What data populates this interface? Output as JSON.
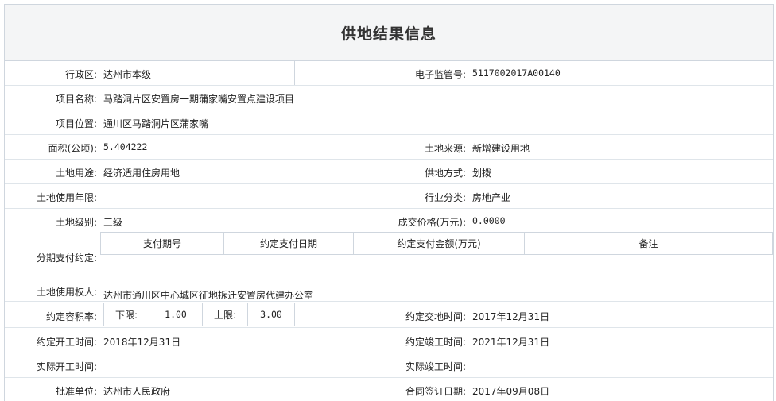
{
  "title": "供地结果信息",
  "fields": {
    "district_label": "行政区:",
    "district_value": "达州市本级",
    "supervision_no_label": "电子监管号:",
    "supervision_no_value": "5117002017A00140",
    "project_name_label": "项目名称:",
    "project_name_value": "马踏洞片区安置房一期蒲家嘴安置点建设项目",
    "project_location_label": "项目位置:",
    "project_location_value": "通川区马踏洞片区蒲家嘴",
    "area_label": "面积(公顷):",
    "area_value": "5.404222",
    "land_source_label": "土地来源:",
    "land_source_value": "新增建设用地",
    "land_use_label": "土地用途:",
    "land_use_value": "经济适用住房用地",
    "supply_method_label": "供地方式:",
    "supply_method_value": "划拨",
    "use_years_label": "土地使用年限:",
    "use_years_value": "",
    "industry_label": "行业分类:",
    "industry_value": "房地产业",
    "land_grade_label": "土地级别:",
    "land_grade_value": "三级",
    "price_label": "成交价格(万元):",
    "price_value": "0.0000",
    "installment_label": "分期支付约定:",
    "installment_headers": [
      "支付期号",
      "约定支付日期",
      "约定支付金额(万元)",
      "备注"
    ],
    "user_label": "土地使用权人:",
    "user_value": "达州市通川区中心城区征地拆迁安置房代建办公室",
    "far_label": "约定容积率:",
    "far_lower_label": "下限:",
    "far_lower_value": "1.00",
    "far_upper_label": "上限:",
    "far_upper_value": "3.00",
    "handover_label": "约定交地时间:",
    "handover_value": "2017年12月31日",
    "start_agreed_label": "约定开工时间:",
    "start_agreed_value": "2018年12月31日",
    "completion_agreed_label": "约定竣工时间:",
    "completion_agreed_value": "2021年12月31日",
    "start_actual_label": "实际开工时间:",
    "start_actual_value": "",
    "completion_actual_label": "实际竣工时间:",
    "completion_actual_value": "",
    "approver_label": "批准单位:",
    "approver_value": "达州市人民政府",
    "contract_date_label": "合同签订日期:",
    "contract_date_value": "2017年09月08日"
  }
}
